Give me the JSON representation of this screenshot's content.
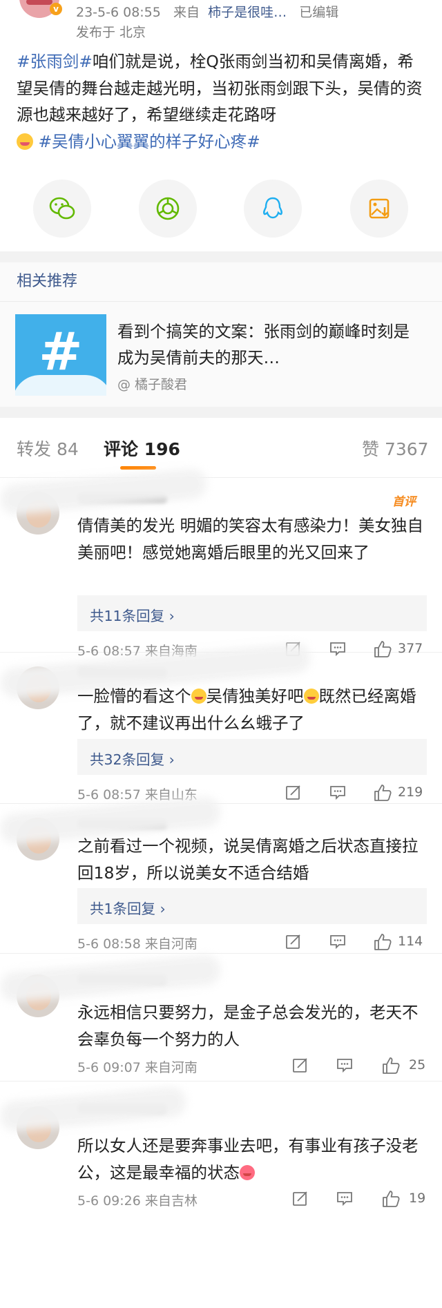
{
  "post": {
    "time": "23-5-6 08:55",
    "source_prefix": "来自",
    "source": "柿子是很哇…",
    "edited": "已编辑",
    "location": "发布于 北京",
    "hashtag1": "#张雨剑#",
    "content": "咱们就是说，栓Q张雨剑当初和吴倩离婚，希望吴倩的舞台越走越光明，当初张雨剑跟下头，吴倩的资源也越来越好了，希望继续走花路呀",
    "hashtag2": "#吴倩小心翼翼的样子好心疼#"
  },
  "share": [
    "wechat-icon",
    "moments-icon",
    "qq-icon",
    "save-image-icon"
  ],
  "related": {
    "title": "相关推荐",
    "item_text": "看到个搞笑的文案：张雨剑的巅峰时刻是成为吴倩前夫的那天…",
    "item_author": "@ 橘子酸君"
  },
  "tabs": {
    "repost": "转发 84",
    "comments": "评论 196",
    "likes": "赞 7367"
  },
  "comments": [
    {
      "text": "倩倩美的发光 明媚的笑容太有感染力！美女独自美丽吧！感觉她离婚后眼里的光又回来了",
      "replies": "共11条回复 ›",
      "time": "5-6 08:57 来自海南",
      "likes": "377",
      "badge": "首评"
    },
    {
      "text_before": "一脸懵的看这个",
      "text_middle": "吴倩独美好吧",
      "text_after": "既然已经离婚了，就不建议再出什么幺蛾子了",
      "replies": "共32条回复 ›",
      "time": "5-6 08:57 来自山东",
      "likes": "219"
    },
    {
      "text": "之前看过一个视频，说吴倩离婚之后状态直接拉回18岁，所以说美女不适合结婚",
      "replies": "共1条回复 ›",
      "time": "5-6 08:58 来自河南",
      "likes": "114"
    },
    {
      "text": "永远相信只要努力，是金子总会发光的，老天不会辜负每一个努力的人",
      "time": "5-6 09:07 来自河南",
      "likes": "25"
    },
    {
      "text": "所以女人还是要奔事业去吧，有事业有孩子没老公，这是最幸福的状态",
      "time": "5-6 09:26 来自吉林",
      "likes": "19"
    }
  ],
  "colors": {
    "link": "#3f6bb6",
    "accent": "#ff8200",
    "badge": "#f68b1f"
  }
}
